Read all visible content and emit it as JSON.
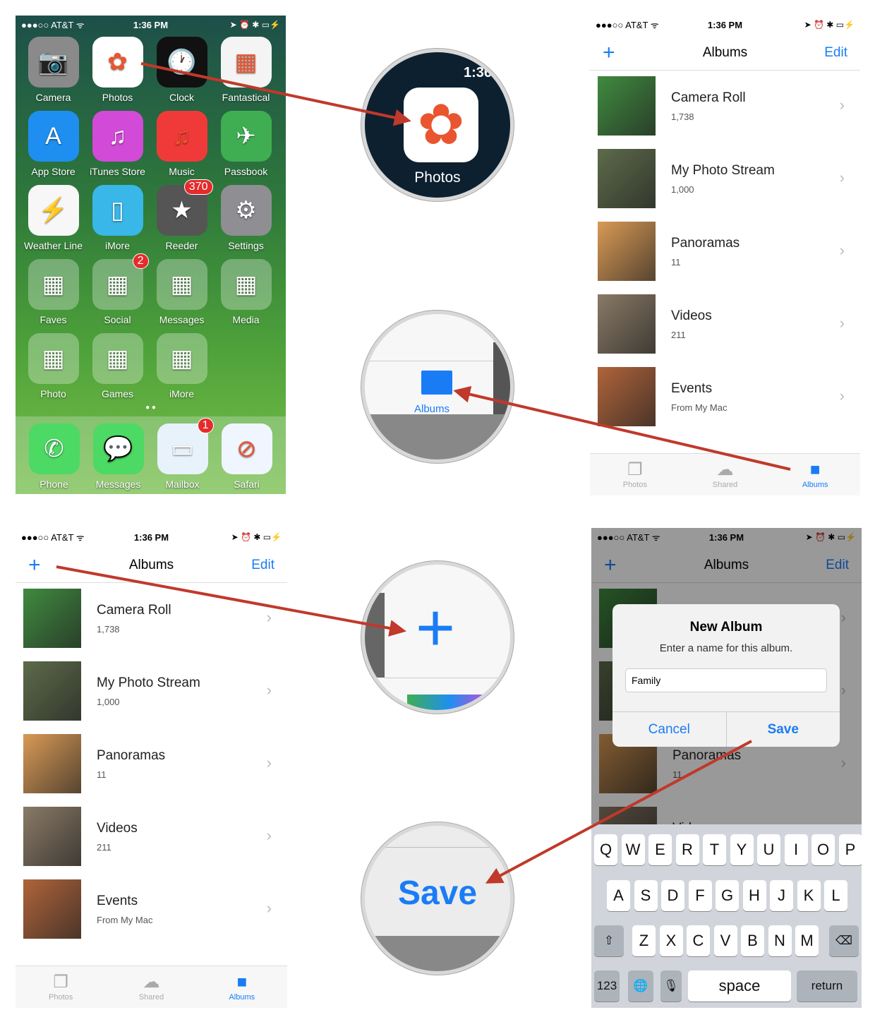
{
  "status_bar": {
    "carrier": "●●●○○ AT&T ᯤ",
    "time": "1:36 PM",
    "right": "➤ ⏰ ✱ ▭⚡"
  },
  "home": {
    "apps": [
      {
        "label": "Camera",
        "color": "#8a8a8a",
        "glyph": "📷"
      },
      {
        "label": "Photos",
        "color": "#ffffff",
        "glyph": "✿"
      },
      {
        "label": "Clock",
        "color": "#111111",
        "glyph": "🕐"
      },
      {
        "label": "Fantastical",
        "color": "#f4f4f4",
        "glyph": "▦"
      },
      {
        "label": "App Store",
        "color": "#1e8ff0",
        "glyph": "A"
      },
      {
        "label": "iTunes Store",
        "color": "#d24ad8",
        "glyph": "♫"
      },
      {
        "label": "Music",
        "color": "#f03a3a",
        "glyph": "♫"
      },
      {
        "label": "Passbook",
        "color": "#3fae52",
        "glyph": "✈"
      },
      {
        "label": "Weather Line",
        "color": "#f7f7f7",
        "glyph": "⚡"
      },
      {
        "label": "iMore",
        "color": "#38b7e8",
        "glyph": "▯"
      },
      {
        "label": "Reeder",
        "color": "#555555",
        "glyph": "★",
        "badge": "370"
      },
      {
        "label": "Settings",
        "color": "#8e8e93",
        "glyph": "⚙"
      },
      {
        "label": "Faves",
        "color": "rgba(255,255,255,0.3)",
        "glyph": "▦"
      },
      {
        "label": "Social",
        "color": "rgba(255,255,255,0.3)",
        "glyph": "▦",
        "badge": "2"
      },
      {
        "label": "Messages",
        "color": "rgba(255,255,255,0.3)",
        "glyph": "▦"
      },
      {
        "label": "Media",
        "color": "rgba(255,255,255,0.3)",
        "glyph": "▦"
      },
      {
        "label": "Photo",
        "color": "rgba(255,255,255,0.3)",
        "glyph": "▦"
      },
      {
        "label": "Games",
        "color": "rgba(255,255,255,0.3)",
        "glyph": "▦"
      },
      {
        "label": "iMore",
        "color": "rgba(255,255,255,0.3)",
        "glyph": "▦"
      }
    ],
    "dock": [
      {
        "label": "Phone",
        "color": "#4cd964",
        "glyph": "✆"
      },
      {
        "label": "Messages",
        "color": "#4cd964",
        "glyph": "💬"
      },
      {
        "label": "Mailbox",
        "color": "#e8f2fb",
        "glyph": "▭",
        "badge": "1"
      },
      {
        "label": "Safari",
        "color": "#f0f6ff",
        "glyph": "⊘"
      }
    ],
    "page_dots": "● ●"
  },
  "albums_screen": {
    "title": "Albums",
    "add": "+",
    "edit": "Edit",
    "albums": [
      {
        "name": "Camera Roll",
        "count": "1,738",
        "thumb": "#3f8a3f"
      },
      {
        "name": "My Photo Stream",
        "count": "1,000",
        "thumb": "#5d6b4a"
      },
      {
        "name": "Panoramas",
        "count": "11",
        "thumb": "#d99a55"
      },
      {
        "name": "Videos",
        "count": "211",
        "thumb": "#8a7a66"
      },
      {
        "name": "Events",
        "count": "From My Mac",
        "thumb": "#b0643a"
      }
    ],
    "tabs": [
      {
        "label": "Photos",
        "icon": "photos-icon",
        "glyph": "❐"
      },
      {
        "label": "Shared",
        "icon": "cloud-icon",
        "glyph": "☁"
      },
      {
        "label": "Albums",
        "icon": "albums-icon",
        "glyph": "■"
      }
    ],
    "active_tab": "Albums"
  },
  "lenses": {
    "photos_label": "Photos",
    "photos_time": "1:36",
    "albums_label": "Albums",
    "plus": "+",
    "save": "Save"
  },
  "dialog": {
    "title": "New Album",
    "message": "Enter a name for this album.",
    "input_value": "Family",
    "cancel": "Cancel",
    "save": "Save"
  },
  "keyboard": {
    "row1": [
      "Q",
      "W",
      "E",
      "R",
      "T",
      "Y",
      "U",
      "I",
      "O",
      "P"
    ],
    "row2": [
      "A",
      "S",
      "D",
      "F",
      "G",
      "H",
      "J",
      "K",
      "L"
    ],
    "row3": [
      "Z",
      "X",
      "C",
      "V",
      "B",
      "N",
      "M"
    ],
    "shift": "⇧",
    "delete": "⌫",
    "numbers": "123",
    "globe": "🌐",
    "mic": "🎙",
    "space": "space",
    "return": "return"
  },
  "colors": {
    "accent": "#1a7cf5",
    "arrow": "#c0392b",
    "badge": "#e52b2b"
  }
}
